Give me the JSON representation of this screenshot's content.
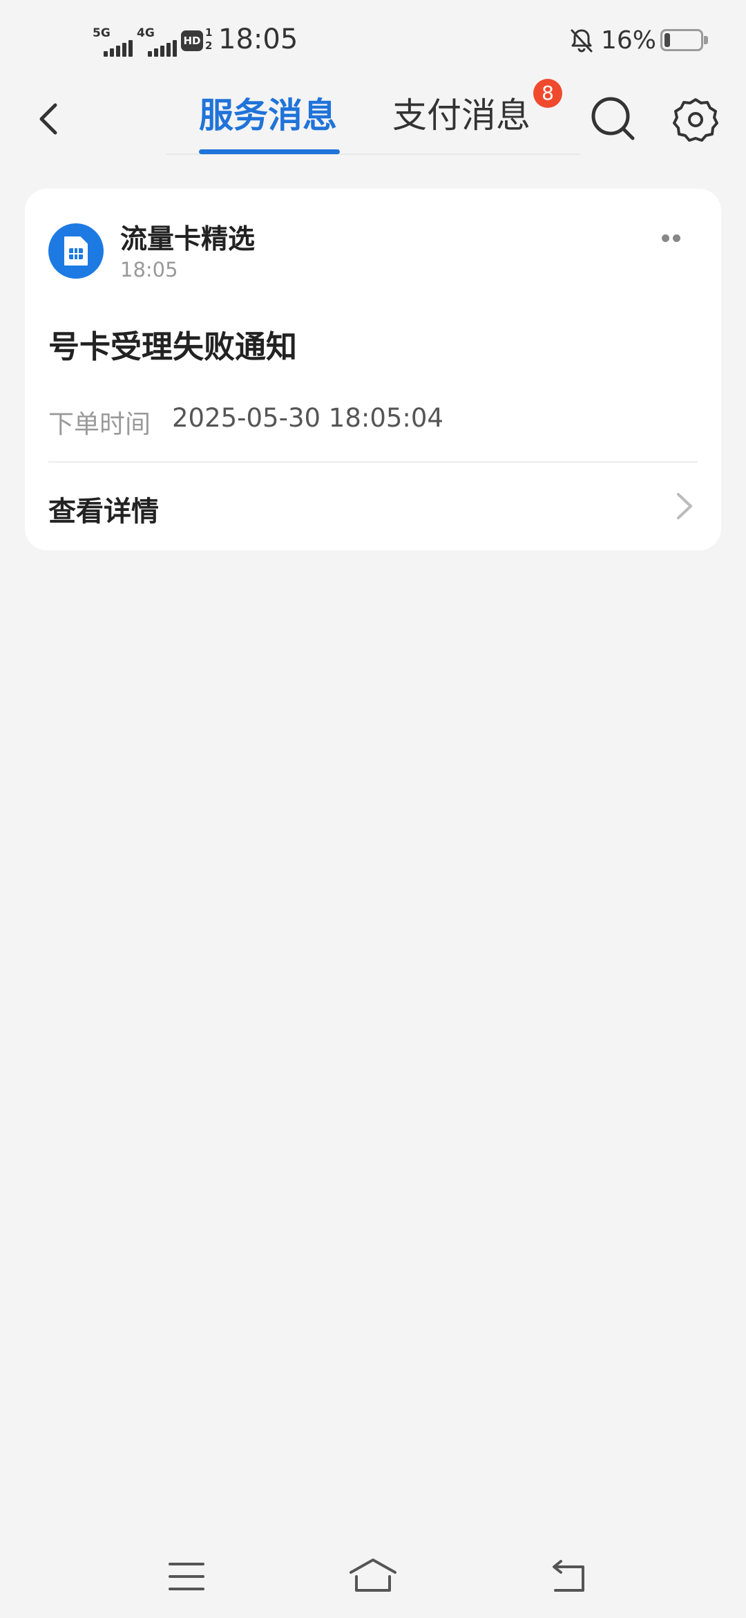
{
  "status_bar": {
    "network_1": "5G",
    "network_2": "4G",
    "hd_label": "HD",
    "hd_sims": "1 2",
    "time": "18:05",
    "battery_percent": "16%",
    "battery_level": 0.16,
    "icons": [
      "signal-5g-icon",
      "signal-4g-icon",
      "hd-voice-icon",
      "bell-muted-icon",
      "battery-icon"
    ]
  },
  "nav": {
    "tabs": [
      {
        "label": "服务消息",
        "active": true
      },
      {
        "label": "支付消息",
        "active": false,
        "badge": "8"
      }
    ],
    "icons": [
      "back-icon",
      "search-icon",
      "gear-icon"
    ],
    "accent_color": "#2073d9",
    "badge_color": "#f04a2e"
  },
  "message": {
    "sender": "流量卡精选",
    "sender_time": "18:05",
    "title": "号卡受理失败通知",
    "order_label": "下单时间",
    "order_value": "2025-05-30 18:05:04",
    "detail_label": "查看详情",
    "avatar_icon": "sim-card-icon",
    "avatar_color": "#1d7ae3"
  },
  "system_nav": {
    "icons": [
      "menu-icon",
      "home-icon",
      "back-nav-icon"
    ]
  }
}
